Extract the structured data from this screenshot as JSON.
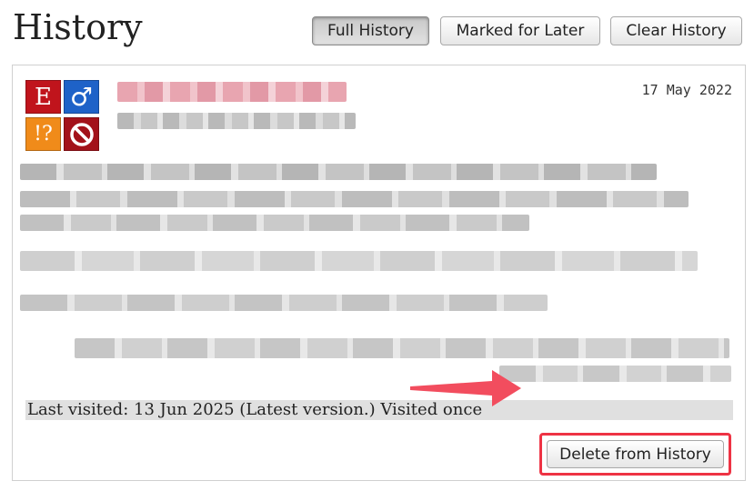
{
  "header": {
    "title": "History",
    "tabs": [
      {
        "label": "Full History",
        "active": true
      },
      {
        "label": "Marked for Later",
        "active": false
      },
      {
        "label": "Clear History",
        "active": false
      }
    ]
  },
  "entry": {
    "tags": [
      {
        "icon": "explicit-icon",
        "glyph": "E",
        "color": "#c0141c"
      },
      {
        "icon": "male-icon",
        "glyph": "♂",
        "color": "#1e62c8"
      },
      {
        "icon": "warning-icon",
        "glyph": "!?",
        "color": "#f08b1a"
      },
      {
        "icon": "prohibited-icon",
        "glyph": "",
        "color": "#a3121a"
      }
    ],
    "date": "17 May 2022",
    "last_visited": "Last visited: 13 Jun 2025 (Latest version.) Visited once",
    "delete_label": "Delete from History"
  },
  "colors": {
    "highlight": "#ee3344",
    "title_blur": "#e8a5b0",
    "text_blur": "#b9b9b9"
  }
}
